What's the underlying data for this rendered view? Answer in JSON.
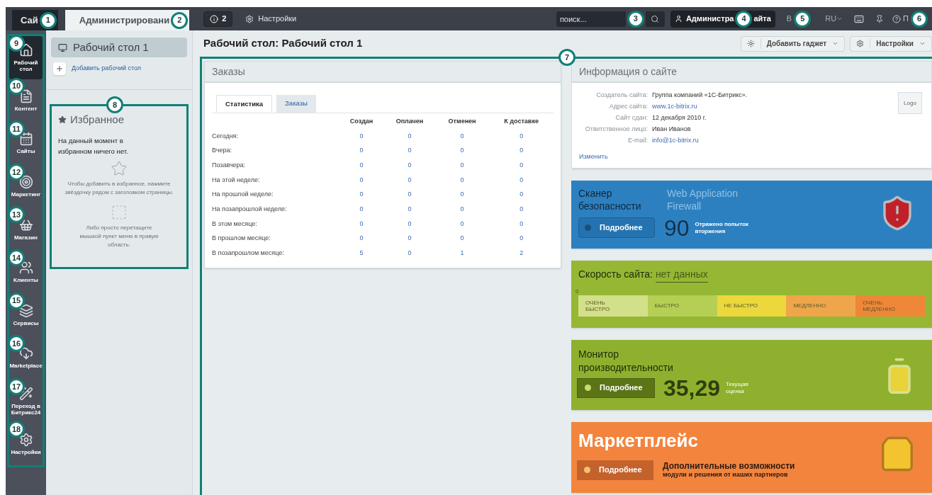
{
  "topbar": {
    "tabs": [
      {
        "label": "Сай",
        "selected": false,
        "callout": "1"
      },
      {
        "label": "Администрировани",
        "selected": true,
        "callout": "2"
      }
    ],
    "notifications": {
      "count": "2"
    },
    "settings": "Настройки",
    "search": {
      "placeholder": "поиск...",
      "callout": "3"
    },
    "user": {
      "label_start": "Администра",
      "label_end": "айта",
      "callout": "4"
    },
    "exit": {
      "label": "В",
      "callout": "5"
    },
    "language": "RU",
    "help": {
      "label": "П",
      "callout": "6"
    }
  },
  "sidebar": {
    "highlighted": true,
    "items": [
      {
        "label": "Рабочий стол",
        "selected": true,
        "callout": "9"
      },
      {
        "label": "Контент",
        "selected": false,
        "callout": "10"
      },
      {
        "label": "Сайты",
        "selected": false,
        "callout": "11"
      },
      {
        "label": "Маркетинг",
        "selected": false,
        "callout": "12"
      },
      {
        "label": "Магазин",
        "selected": false,
        "callout": "13"
      },
      {
        "label": "Клиенты",
        "selected": false,
        "callout": "14"
      },
      {
        "label": "Сервисы",
        "selected": false,
        "callout": "15"
      },
      {
        "label": "Marketplace",
        "selected": false,
        "callout": "16"
      },
      {
        "label": "Переход в Битрикс24",
        "selected": false,
        "callout": "17"
      },
      {
        "label": "Настройки",
        "selected": false,
        "callout": "18"
      }
    ]
  },
  "desktops": {
    "items": [
      {
        "label": "Рабочий стол 1",
        "selected": true
      }
    ],
    "add_link": "Добавить рабочий стол"
  },
  "favorites": {
    "highlighted": true,
    "callout": "8",
    "title": "Избранное",
    "empty_message": "На данный момент в избранном ничего нет.",
    "hint_star": "Чтобы добавить в избранное, нажмите звёздочку рядом с заголовком страницы.",
    "hint_drag": "Либо просто перетащите мышкой пункт меню в правую область."
  },
  "page": {
    "title": "Рабочий стол: Рабочий стол 1",
    "buttons": [
      {
        "label": "Добавить гаджет"
      },
      {
        "label": "Настройки"
      }
    ]
  },
  "content": {
    "highlighted": true,
    "callout": "7"
  },
  "orders_widget": {
    "title": "Заказы",
    "tabs": [
      {
        "label": "Статистика",
        "selected": true
      },
      {
        "label": "Заказы",
        "selected": false
      }
    ],
    "columns": [
      "Создан",
      "Оплачен",
      "Отменен",
      "К доставке"
    ],
    "rows": [
      {
        "label": "Сегодня:",
        "values": [
          "0",
          "0",
          "0",
          "0"
        ]
      },
      {
        "label": "Вчера:",
        "values": [
          "0",
          "0",
          "0",
          "0"
        ]
      },
      {
        "label": "Позавчера:",
        "values": [
          "0",
          "0",
          "0",
          "0"
        ]
      },
      {
        "label": "На этой неделе:",
        "values": [
          "0",
          "0",
          "0",
          "0"
        ]
      },
      {
        "label": "На прошлой неделе:",
        "values": [
          "0",
          "0",
          "0",
          "0"
        ]
      },
      {
        "label": "На позапрошлой неделе:",
        "values": [
          "0",
          "0",
          "0",
          "0"
        ]
      },
      {
        "label": "В этом месяце:",
        "values": [
          "0",
          "0",
          "0",
          "0"
        ]
      },
      {
        "label": "В прошлом месяце:",
        "values": [
          "0",
          "0",
          "0",
          "0"
        ]
      },
      {
        "label": "В позапрошлом месяце:",
        "values": [
          "5",
          "0",
          "1",
          "2"
        ]
      }
    ]
  },
  "site_info": {
    "title": "Информация о сайте",
    "fields": [
      {
        "label": "Создатель сайта:",
        "value": "Группа компаний «1С-Битрикс».",
        "kind": "text"
      },
      {
        "label": "Адрес сайта:",
        "value": "www.1c-bitrix.ru",
        "kind": "link"
      },
      {
        "label": "Сайт сдан:",
        "value": "12 декабря 2010 г.",
        "kind": "text"
      },
      {
        "label": "Ответственное лицо:",
        "value": "Иван Иванов",
        "kind": "text"
      },
      {
        "label": "E-mail:",
        "value": "info@1c-bitrix.ru",
        "kind": "link"
      }
    ],
    "logo": "Logo",
    "edit_link": "Изменить"
  },
  "security": {
    "title": "Сканер безопасности",
    "subtitle": "Web Application Firewall",
    "button": "Подробнее",
    "count": "90",
    "caption": "Отражено попыток вторжения"
  },
  "speed": {
    "title": "Скорость сайта:",
    "value": "нет данных",
    "scale_start": "0",
    "segments": [
      {
        "label": "ОЧЕНЬ БЫСТРО",
        "color": "#d3e08a"
      },
      {
        "label": "БЫСТРО",
        "color": "#b5cf54"
      },
      {
        "label": "НЕ БЫСТРО",
        "color": "#ecd83c"
      },
      {
        "label": "МЕДЛЕННО",
        "color": "#efa64a"
      },
      {
        "label": "ОЧЕНЬ МЕДЛЕННО",
        "color": "#ee8738"
      }
    ]
  },
  "monitor": {
    "title": "Монитор производительности",
    "button": "Подробнее",
    "score": "35,29",
    "caption": "Текущая оценка"
  },
  "marketplace": {
    "title": "Маркетплейс",
    "button": "Подробнее",
    "headline": "Дополнительные возможности",
    "subline": "модули и решения от наших партнеров"
  }
}
